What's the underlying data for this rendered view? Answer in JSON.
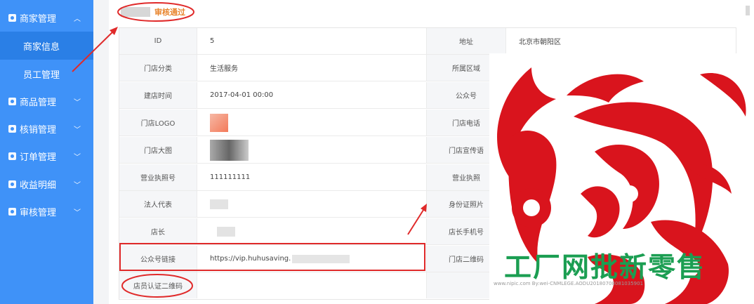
{
  "sidebar": {
    "menus": [
      {
        "label": "商家管理",
        "icon": "shop-icon",
        "expanded": true
      },
      {
        "label": "商品管理",
        "icon": "goods-icon"
      },
      {
        "label": "核销管理",
        "icon": "verify-icon"
      },
      {
        "label": "订单管理",
        "icon": "order-icon"
      },
      {
        "label": "收益明细",
        "icon": "income-icon"
      },
      {
        "label": "审核管理",
        "icon": "audit-icon"
      }
    ],
    "submenus": [
      {
        "label": "商家信息",
        "active": true
      },
      {
        "label": "员工管理"
      }
    ]
  },
  "status": {
    "label": "审核通过"
  },
  "details": {
    "rows": [
      {
        "l1": "ID",
        "v1": "5",
        "l2": "地址",
        "v2": "北京市朝阳区"
      },
      {
        "l1": "门店分类",
        "v1": "生活服务",
        "l2": "所属区域",
        "v2": ""
      },
      {
        "l1": "建店时间",
        "v1": "2017-04-01 00:00",
        "l2": "公众号",
        "v2": ""
      },
      {
        "l1": "门店LOGO",
        "v1": "",
        "l2": "门店电话",
        "v2": ""
      },
      {
        "l1": "门店大图",
        "v1": "",
        "l2": "门店宣传语",
        "v2": ""
      },
      {
        "l1": "营业执照号",
        "v1": "111111111",
        "l2": "营业执照",
        "v2": ""
      },
      {
        "l1": "法人代表",
        "v1": "",
        "l2": "身份证照片",
        "v2": ""
      },
      {
        "l1": "店长",
        "v1": "",
        "l2": "店长手机号",
        "v2": ""
      },
      {
        "l1": "公众号链接",
        "v1": "https://vip.huhusaving.",
        "l2": "门店二维码",
        "v2": ""
      },
      {
        "l1": "店员认证二维码",
        "v1": "",
        "l2": "",
        "v2": ""
      }
    ]
  },
  "overlay": {
    "caption": "工厂网批新零售",
    "watermark": "www.nipic.com   By:wei-CNMLEGE.AODU20180708081035901"
  },
  "colors": {
    "sidebar": "#3f92f8",
    "active": "#2a7fe6",
    "status": "#e8842c",
    "annotation": "#e02a2a",
    "fu_red": "#d9141d",
    "caption": "#1b9e52"
  }
}
